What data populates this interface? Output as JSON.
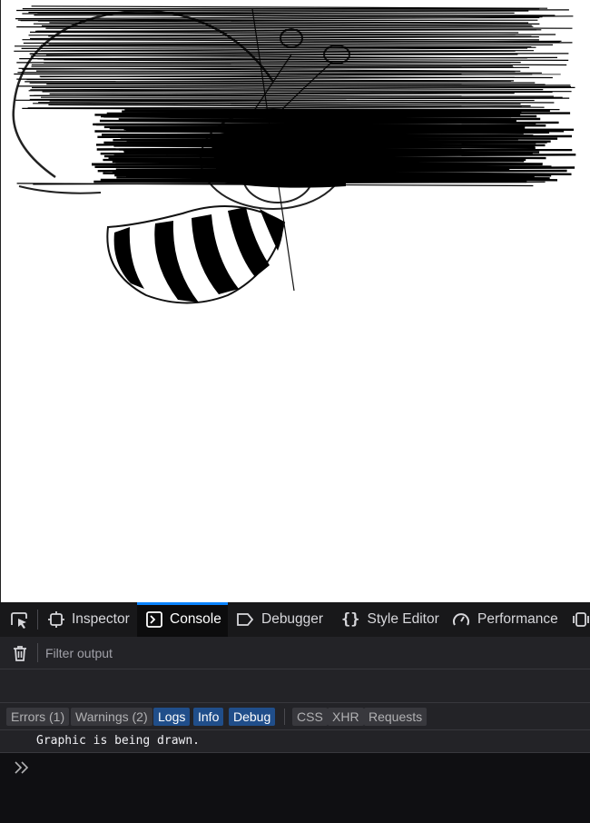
{
  "page": {
    "drawing_description_icon": "bee-drawing"
  },
  "devtools": {
    "tabs": [
      {
        "label": "Inspector",
        "icon": "inspector-icon",
        "selected": false
      },
      {
        "label": "Console",
        "icon": "console-icon",
        "selected": true
      },
      {
        "label": "Debugger",
        "icon": "debugger-icon",
        "selected": false
      },
      {
        "label": "Style Editor",
        "icon": "style-editor-icon",
        "selected": false
      },
      {
        "label": "Performance",
        "icon": "performance-icon",
        "selected": false
      }
    ],
    "filter": {
      "placeholder": "Filter output",
      "value": ""
    },
    "levels": [
      {
        "label": "Errors (1)",
        "on": false
      },
      {
        "label": "Warnings (2)",
        "on": false
      },
      {
        "label": "Logs",
        "on": true
      },
      {
        "label": "Info",
        "on": true
      },
      {
        "label": "Debug",
        "on": true
      },
      {
        "label": "CSS",
        "on": false
      },
      {
        "label": "XHR",
        "on": false
      },
      {
        "label": "Requests",
        "on": false
      }
    ],
    "messages": [
      {
        "text": "Graphic is being drawn."
      }
    ],
    "colors": {
      "accent": "#0a84ff",
      "toolbar_bg": "#18181a",
      "panel_bg": "#232327",
      "filter_on_bg": "#204e8a"
    }
  }
}
